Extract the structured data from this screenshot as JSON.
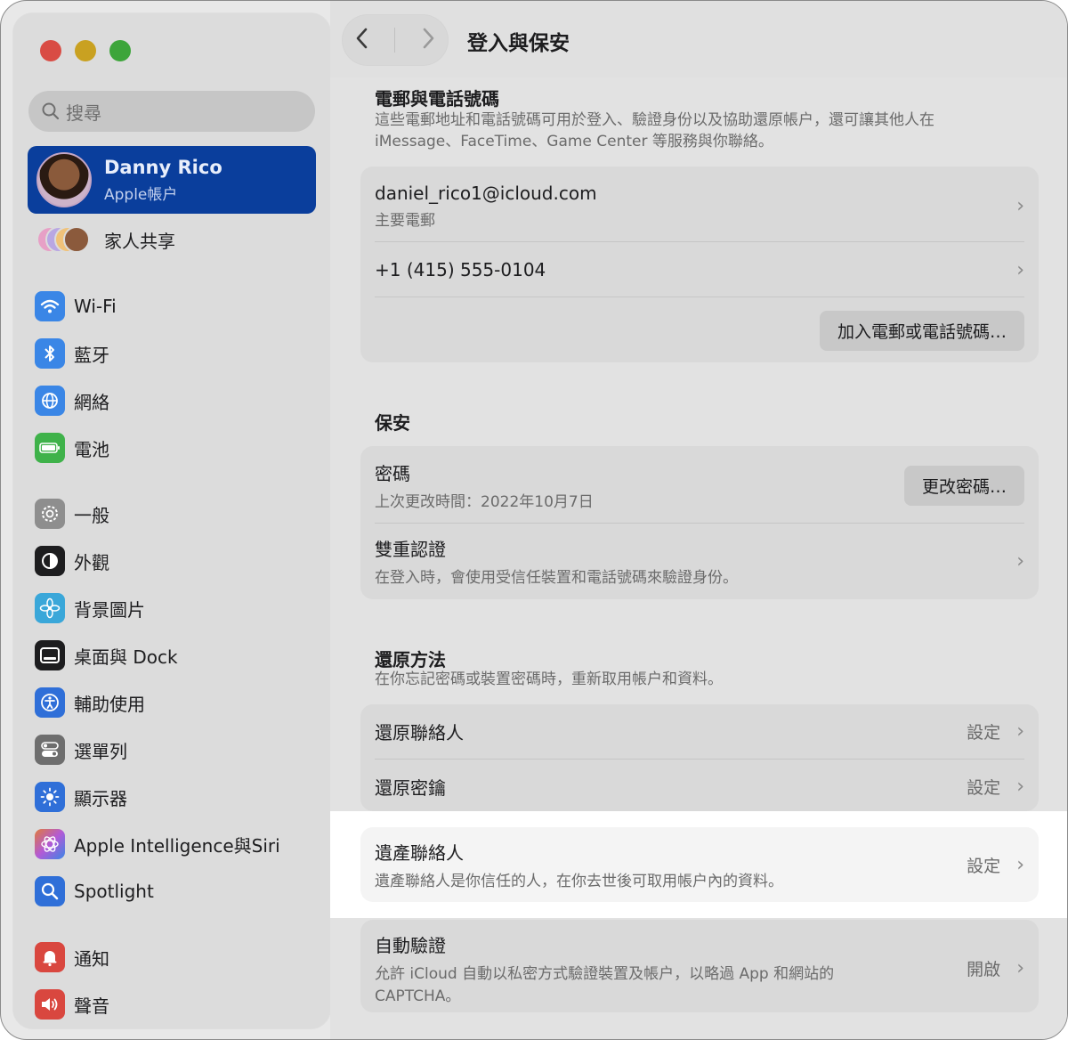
{
  "window": {
    "title": "登入與保安"
  },
  "sidebar": {
    "search_placeholder": "搜尋",
    "account": {
      "name": "Danny Rico",
      "subtitle": "Apple帳户"
    },
    "family_label": "家人共享",
    "items": [
      {
        "label": "Wi-Fi",
        "icon": "wifi-icon",
        "color": "#3a86e6"
      },
      {
        "label": "藍牙",
        "icon": "bluetooth-icon",
        "color": "#3a86e6"
      },
      {
        "label": "網絡",
        "icon": "globe-icon",
        "color": "#3a86e6"
      },
      {
        "label": "電池",
        "icon": "battery-icon",
        "color": "#3fb24a"
      },
      {
        "label": "一般",
        "icon": "gear-icon",
        "color": "#8e8e8e"
      },
      {
        "label": "外觀",
        "icon": "appearance-icon",
        "color": "#1d1d1f"
      },
      {
        "label": "背景圖片",
        "icon": "flower-icon",
        "color": "#3aa7d9"
      },
      {
        "label": "桌面與 Dock",
        "icon": "dock-icon",
        "color": "#1d1d1f"
      },
      {
        "label": "輔助使用",
        "icon": "accessibility-icon",
        "color": "#2f6fd8"
      },
      {
        "label": "選單列",
        "icon": "menubar-icon",
        "color": "#6e6e6e"
      },
      {
        "label": "顯示器",
        "icon": "brightness-icon",
        "color": "#2f6fd8"
      },
      {
        "label": "Apple Intelligence與Siri",
        "icon": "siri-icon",
        "color": "#b25ad6"
      },
      {
        "label": "Spotlight",
        "icon": "spotlight-icon",
        "color": "#2f6fd8"
      },
      {
        "label": "通知",
        "icon": "bell-icon",
        "color": "#d9473f"
      },
      {
        "label": "聲音",
        "icon": "speaker-icon",
        "color": "#d9473f"
      }
    ]
  },
  "email_phone": {
    "title": "電郵與電話號碼",
    "desc_line1": "這些電郵地址和電話號碼可用於登入、驗證身份以及協助還原帳户，還可讓其他人在",
    "desc_line2": "iMessage、FaceTime、Game Center 等服務與你聯絡。",
    "email": "daniel_rico1@icloud.com",
    "email_sub": "主要電郵",
    "phone": "+1 (415) 555-0104",
    "add_button": "加入電郵或電話號碼…"
  },
  "security": {
    "title": "保安",
    "password_label": "密碼",
    "password_sub": "上次更改時間：2022年10月7日",
    "change_password_button": "更改密碼…",
    "two_factor_label": "雙重認證",
    "two_factor_sub": "在登入時，會使用受信任裝置和電話號碼來驗證身份。"
  },
  "recovery": {
    "title": "還原方法",
    "desc": "在你忘記密碼或裝置密碼時，重新取用帳户和資料。",
    "contacts_label": "還原聯絡人",
    "contacts_value": "設定",
    "key_label": "還原密鑰",
    "key_value": "設定"
  },
  "legacy": {
    "label": "遺產聯絡人",
    "sub": "遺產聯絡人是你信任的人，在你去世後可取用帳户內的資料。",
    "value": "設定"
  },
  "auto_verify": {
    "label": "自動驗證",
    "sub_line1": "允許 iCloud 自動以私密方式驗證裝置及帳户，以略過 App 和網站的",
    "sub_line2": "CAPTCHA。",
    "value": "開啟"
  }
}
